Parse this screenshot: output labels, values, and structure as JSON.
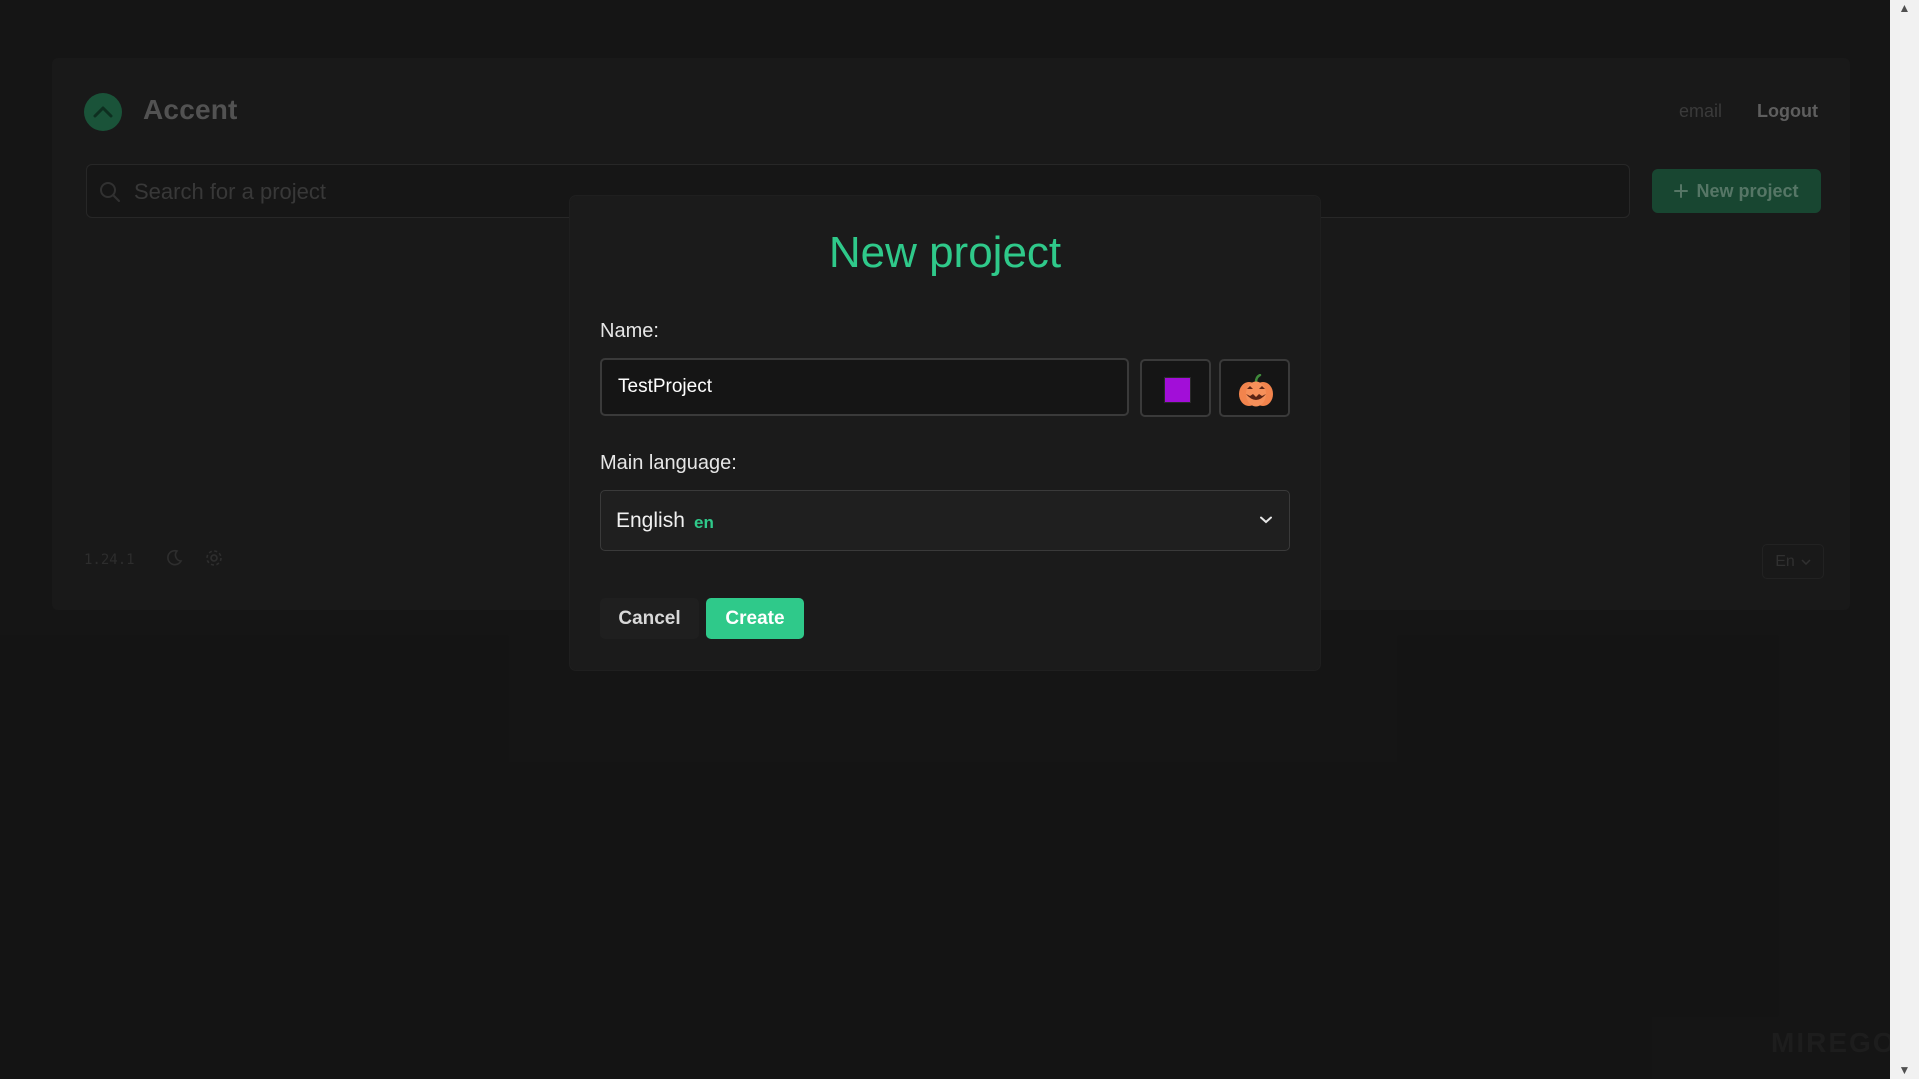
{
  "app": {
    "name": "Accent",
    "version": "1.24.1",
    "brand_watermark": "MIREGO",
    "accent_color": "#2fc98a"
  },
  "header": {
    "email_label": "email",
    "logout_label": "Logout"
  },
  "search": {
    "placeholder": "Search for a project"
  },
  "toolbar": {
    "new_project_label": "New project"
  },
  "footer": {
    "language_selector": "En"
  },
  "modal": {
    "title": "New project",
    "name_label": "Name:",
    "name_value": "TestProject",
    "selected_color": "#a20ed8",
    "selected_emoji": "pumpkin-icon",
    "main_language_label": "Main language:",
    "main_language_name": "English",
    "main_language_code": "en",
    "cancel_label": "Cancel",
    "create_label": "Create"
  }
}
